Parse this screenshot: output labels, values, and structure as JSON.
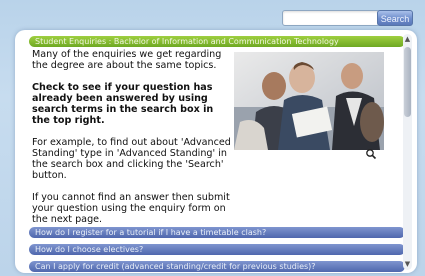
{
  "search": {
    "placeholder": "",
    "value": "",
    "button_label": "Search"
  },
  "faq": {
    "active_title": "Student Enquiries : Bachelor of Information and Communication Technology",
    "paragraphs": [
      "Many of the enquiries we get regarding the degree are about the same topics.",
      "Check to see if your question has already been answered by using search terms in the search box in the top right.",
      "For example, to find out about 'Advanced Standing' type in 'Advanced Standing' in the search box and clicking the 'Search' button.",
      "If you cannot find an answer then submit your question using the enquiry form on the next page."
    ],
    "questions": [
      "How do I register for a tutorial if I have a timetable clash?",
      "How do I choose electives?",
      "Can I apply for credit (advanced standing/credit for previous studies)?"
    ]
  },
  "colors": {
    "active_header": "#7bb32a",
    "question_header": "#5a72b6"
  },
  "icons": {
    "zoom": "magnifier-icon",
    "scroll_up": "chevron-up-icon",
    "scroll_down": "chevron-down-icon"
  }
}
